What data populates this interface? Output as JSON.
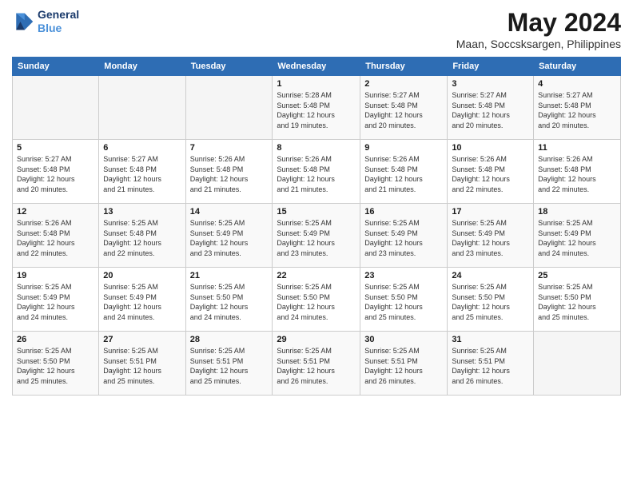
{
  "logo": {
    "line1": "General",
    "line2": "Blue"
  },
  "title": "May 2024",
  "subtitle": "Maan, Soccsksargen, Philippines",
  "days_header": [
    "Sunday",
    "Monday",
    "Tuesday",
    "Wednesday",
    "Thursday",
    "Friday",
    "Saturday"
  ],
  "weeks": [
    [
      {
        "day": "",
        "info": ""
      },
      {
        "day": "",
        "info": ""
      },
      {
        "day": "",
        "info": ""
      },
      {
        "day": "1",
        "info": "Sunrise: 5:28 AM\nSunset: 5:48 PM\nDaylight: 12 hours\nand 19 minutes."
      },
      {
        "day": "2",
        "info": "Sunrise: 5:27 AM\nSunset: 5:48 PM\nDaylight: 12 hours\nand 20 minutes."
      },
      {
        "day": "3",
        "info": "Sunrise: 5:27 AM\nSunset: 5:48 PM\nDaylight: 12 hours\nand 20 minutes."
      },
      {
        "day": "4",
        "info": "Sunrise: 5:27 AM\nSunset: 5:48 PM\nDaylight: 12 hours\nand 20 minutes."
      }
    ],
    [
      {
        "day": "5",
        "info": "Sunrise: 5:27 AM\nSunset: 5:48 PM\nDaylight: 12 hours\nand 20 minutes."
      },
      {
        "day": "6",
        "info": "Sunrise: 5:27 AM\nSunset: 5:48 PM\nDaylight: 12 hours\nand 21 minutes."
      },
      {
        "day": "7",
        "info": "Sunrise: 5:26 AM\nSunset: 5:48 PM\nDaylight: 12 hours\nand 21 minutes."
      },
      {
        "day": "8",
        "info": "Sunrise: 5:26 AM\nSunset: 5:48 PM\nDaylight: 12 hours\nand 21 minutes."
      },
      {
        "day": "9",
        "info": "Sunrise: 5:26 AM\nSunset: 5:48 PM\nDaylight: 12 hours\nand 21 minutes."
      },
      {
        "day": "10",
        "info": "Sunrise: 5:26 AM\nSunset: 5:48 PM\nDaylight: 12 hours\nand 22 minutes."
      },
      {
        "day": "11",
        "info": "Sunrise: 5:26 AM\nSunset: 5:48 PM\nDaylight: 12 hours\nand 22 minutes."
      }
    ],
    [
      {
        "day": "12",
        "info": "Sunrise: 5:26 AM\nSunset: 5:48 PM\nDaylight: 12 hours\nand 22 minutes."
      },
      {
        "day": "13",
        "info": "Sunrise: 5:25 AM\nSunset: 5:48 PM\nDaylight: 12 hours\nand 22 minutes."
      },
      {
        "day": "14",
        "info": "Sunrise: 5:25 AM\nSunset: 5:49 PM\nDaylight: 12 hours\nand 23 minutes."
      },
      {
        "day": "15",
        "info": "Sunrise: 5:25 AM\nSunset: 5:49 PM\nDaylight: 12 hours\nand 23 minutes."
      },
      {
        "day": "16",
        "info": "Sunrise: 5:25 AM\nSunset: 5:49 PM\nDaylight: 12 hours\nand 23 minutes."
      },
      {
        "day": "17",
        "info": "Sunrise: 5:25 AM\nSunset: 5:49 PM\nDaylight: 12 hours\nand 23 minutes."
      },
      {
        "day": "18",
        "info": "Sunrise: 5:25 AM\nSunset: 5:49 PM\nDaylight: 12 hours\nand 24 minutes."
      }
    ],
    [
      {
        "day": "19",
        "info": "Sunrise: 5:25 AM\nSunset: 5:49 PM\nDaylight: 12 hours\nand 24 minutes."
      },
      {
        "day": "20",
        "info": "Sunrise: 5:25 AM\nSunset: 5:49 PM\nDaylight: 12 hours\nand 24 minutes."
      },
      {
        "day": "21",
        "info": "Sunrise: 5:25 AM\nSunset: 5:50 PM\nDaylight: 12 hours\nand 24 minutes."
      },
      {
        "day": "22",
        "info": "Sunrise: 5:25 AM\nSunset: 5:50 PM\nDaylight: 12 hours\nand 24 minutes."
      },
      {
        "day": "23",
        "info": "Sunrise: 5:25 AM\nSunset: 5:50 PM\nDaylight: 12 hours\nand 25 minutes."
      },
      {
        "day": "24",
        "info": "Sunrise: 5:25 AM\nSunset: 5:50 PM\nDaylight: 12 hours\nand 25 minutes."
      },
      {
        "day": "25",
        "info": "Sunrise: 5:25 AM\nSunset: 5:50 PM\nDaylight: 12 hours\nand 25 minutes."
      }
    ],
    [
      {
        "day": "26",
        "info": "Sunrise: 5:25 AM\nSunset: 5:50 PM\nDaylight: 12 hours\nand 25 minutes."
      },
      {
        "day": "27",
        "info": "Sunrise: 5:25 AM\nSunset: 5:51 PM\nDaylight: 12 hours\nand 25 minutes."
      },
      {
        "day": "28",
        "info": "Sunrise: 5:25 AM\nSunset: 5:51 PM\nDaylight: 12 hours\nand 25 minutes."
      },
      {
        "day": "29",
        "info": "Sunrise: 5:25 AM\nSunset: 5:51 PM\nDaylight: 12 hours\nand 26 minutes."
      },
      {
        "day": "30",
        "info": "Sunrise: 5:25 AM\nSunset: 5:51 PM\nDaylight: 12 hours\nand 26 minutes."
      },
      {
        "day": "31",
        "info": "Sunrise: 5:25 AM\nSunset: 5:51 PM\nDaylight: 12 hours\nand 26 minutes."
      },
      {
        "day": "",
        "info": ""
      }
    ]
  ]
}
